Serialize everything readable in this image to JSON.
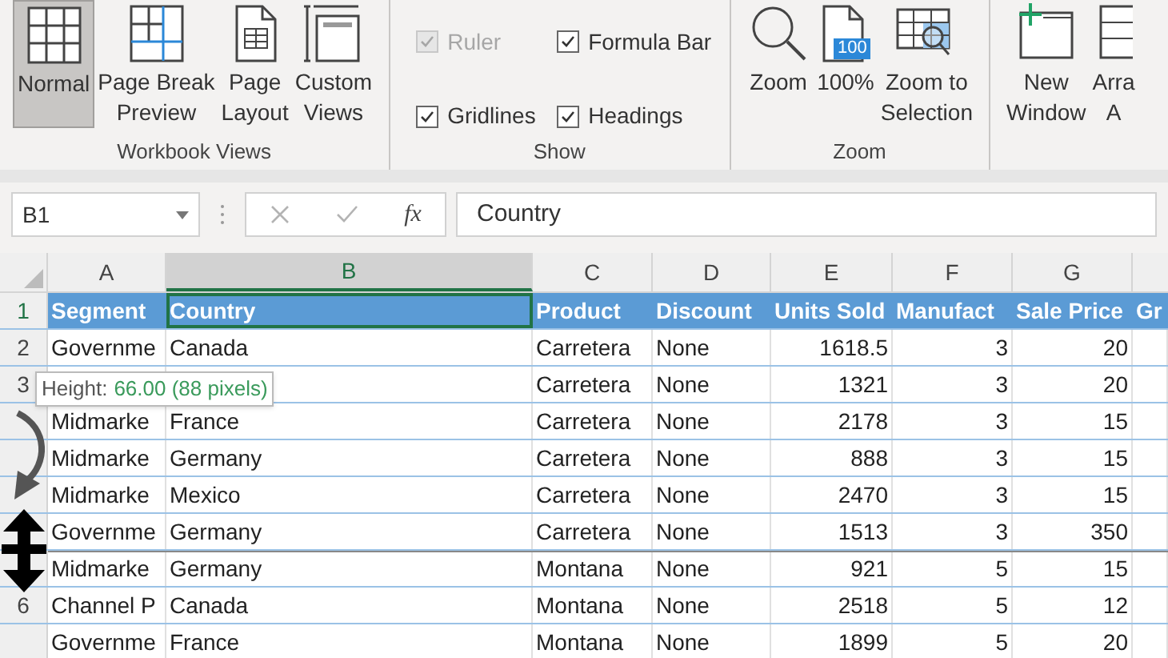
{
  "ribbon": {
    "groups": [
      {
        "kind": "buttons",
        "label": "Workbook Views",
        "buttons": [
          {
            "lines": [
              "Normal"
            ],
            "selected": true
          },
          {
            "lines": [
              "Page Break",
              "Preview"
            ],
            "selected": false
          },
          {
            "lines": [
              "Page",
              "Layout"
            ],
            "selected": false
          },
          {
            "lines": [
              "Custom",
              "Views"
            ],
            "selected": false
          }
        ]
      },
      {
        "kind": "checks",
        "label": "Show",
        "items": [
          {
            "label": "Ruler",
            "checked": true,
            "disabled": true
          },
          {
            "label": "Formula Bar",
            "checked": true,
            "disabled": false
          },
          {
            "label": "Gridlines",
            "checked": true,
            "disabled": false
          },
          {
            "label": "Headings",
            "checked": true,
            "disabled": false
          }
        ]
      },
      {
        "kind": "buttons",
        "label": "Zoom",
        "buttons": [
          {
            "lines": [
              "Zoom"
            ]
          },
          {
            "badge": "100",
            "lines": [
              "100%"
            ]
          },
          {
            "lines": [
              "Zoom to",
              "Selection"
            ]
          }
        ]
      },
      {
        "kind": "buttons",
        "buttons": [
          {
            "lines": [
              "New",
              "Window"
            ]
          },
          {
            "lines": [
              "Arra",
              "A"
            ]
          }
        ]
      }
    ]
  },
  "formula_bar": {
    "name_box": "B1",
    "function_label": "fx",
    "formula": "Country"
  },
  "sheet": {
    "columns": [
      {
        "label": "A",
        "selected": false
      },
      {
        "label": "B",
        "selected": true
      },
      {
        "label": "C",
        "selected": false
      },
      {
        "label": "D",
        "selected": false
      },
      {
        "label": "E",
        "selected": false
      },
      {
        "label": "F",
        "selected": false
      },
      {
        "label": "G",
        "selected": false
      }
    ],
    "rows": [
      {
        "header": "1",
        "kind": "heading",
        "cells": [
          "Segment",
          "Country",
          "Product",
          "Discount",
          "Units Sold",
          "Manufact",
          "Sale Price",
          "Gr"
        ]
      },
      {
        "header": "2",
        "kind": "data",
        "cells": [
          "Governme",
          "Canada",
          "Carretera",
          "None",
          "1618.5",
          "3",
          "20"
        ]
      },
      {
        "header": "3",
        "kind": "data",
        "cells": [
          null,
          null,
          "Carretera",
          "None",
          "1321",
          "3",
          "20"
        ]
      },
      {
        "kind": "data",
        "cells": [
          "Midmarke",
          "France",
          "Carretera",
          "None",
          "2178",
          "3",
          "15"
        ]
      },
      {
        "kind": "data",
        "cells": [
          "Midmarke",
          "Germany",
          "Carretera",
          "None",
          "888",
          "3",
          "15"
        ]
      },
      {
        "kind": "data",
        "cells": [
          "Midmarke",
          "Mexico",
          "Carretera",
          "None",
          "2470",
          "3",
          "15"
        ]
      },
      {
        "kind": "data",
        "cells": [
          "Governme",
          "Germany",
          "Carretera",
          "None",
          "1513",
          "3",
          "350"
        ]
      },
      {
        "kind": "data",
        "cells": [
          "Midmarke",
          "Germany",
          "Montana",
          "None",
          "921",
          "5",
          "15"
        ]
      },
      {
        "header": "6",
        "kind": "data",
        "cells": [
          "Channel P",
          "Canada",
          "Montana",
          "None",
          "2518",
          "5",
          "12"
        ]
      },
      {
        "kind": "data",
        "cells": [
          "Governme",
          "France",
          "Montana",
          "None",
          "1899",
          "5",
          "20"
        ]
      }
    ]
  },
  "tooltip": {
    "label": "Height:",
    "value": "66.00 (88 pixels)"
  }
}
